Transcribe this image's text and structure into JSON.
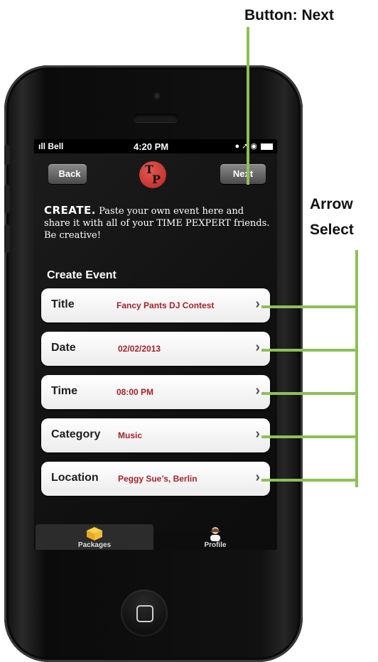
{
  "callouts": {
    "next": "Button: Next",
    "arrow_line1": "Arrow",
    "arrow_line2": "Select"
  },
  "status": {
    "carrier": "Bell",
    "time": "4:20 PM"
  },
  "nav": {
    "back": "Back",
    "next": "Next"
  },
  "intro": {
    "lead": "CREATE.",
    "text": " Paste your own event here and share it with all of your TIME PEXPERT friends. Be creative!"
  },
  "section_title": "Create Event",
  "rows": [
    {
      "label": "Title",
      "value": "Fancy Pants DJ Contest"
    },
    {
      "label": "Date",
      "value": "02/02/2013"
    },
    {
      "label": "Time",
      "value": "08:00 PM"
    },
    {
      "label": "Category",
      "value": "Music"
    },
    {
      "label": "Location",
      "value": "Peggy Sue’s, Berlin"
    }
  ],
  "tabs": [
    {
      "label": "Packages",
      "icon": "package-icon",
      "active": true
    },
    {
      "label": "Profile",
      "icon": "profile-icon",
      "active": false
    }
  ],
  "colors": {
    "value_text": "#a2232a",
    "guide_line": "#8ebf59"
  }
}
